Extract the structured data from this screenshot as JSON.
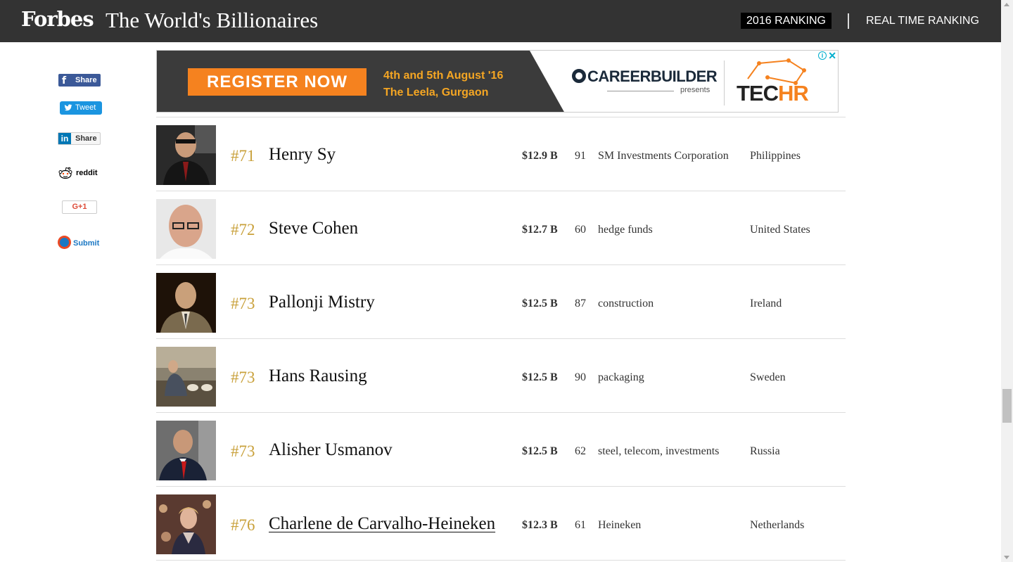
{
  "header": {
    "logo": "Forbes",
    "title": "The World's Billionaires",
    "tab_2016": "2016 RANKING",
    "tab_realtime": "REAL TIME RANKING"
  },
  "share": {
    "facebook": "Share",
    "twitter": "Tweet",
    "linkedin": "Share",
    "reddit": "reddit",
    "gplus": "G+1",
    "stumbleupon": "Submit"
  },
  "ad": {
    "cta": "REGISTER NOW",
    "date_line1": "4th and 5th August '16",
    "date_line2": "The Leela, Gurgaon",
    "brand": "CAREERBUILDER",
    "presents": "presents",
    "event_prefix": "TEC",
    "event_suffix": "HR"
  },
  "billionaires": [
    {
      "rank": "#71",
      "name": "Henry Sy",
      "worth": "$12.9 B",
      "age": "91",
      "source": "SM Investments Corporation",
      "country": "Philippines"
    },
    {
      "rank": "#72",
      "name": "Steve Cohen",
      "worth": "$12.7 B",
      "age": "60",
      "source": "hedge funds",
      "country": "United States"
    },
    {
      "rank": "#73",
      "name": "Pallonji Mistry",
      "worth": "$12.5 B",
      "age": "87",
      "source": "construction",
      "country": "Ireland"
    },
    {
      "rank": "#73",
      "name": "Hans Rausing",
      "worth": "$12.5 B",
      "age": "90",
      "source": "packaging",
      "country": "Sweden"
    },
    {
      "rank": "#73",
      "name": "Alisher Usmanov",
      "worth": "$12.5 B",
      "age": "62",
      "source": "steel, telecom, investments",
      "country": "Russia"
    },
    {
      "rank": "#76",
      "name": "Charlene de Carvalho-Heineken",
      "worth": "$12.3 B",
      "age": "61",
      "source": "Heineken",
      "country": "Netherlands"
    }
  ],
  "colors": {
    "header_bg": "#333333",
    "rank_gold": "#c9a13b",
    "ad_orange": "#f5821f"
  }
}
